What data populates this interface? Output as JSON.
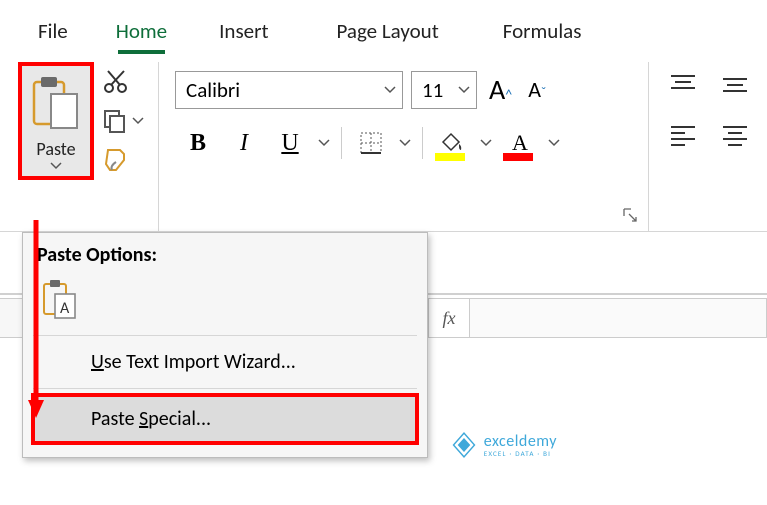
{
  "tabs": {
    "file": "File",
    "home": "Home",
    "insert": "Insert",
    "page_layout": "Page Layout",
    "formulas": "Formulas"
  },
  "clipboard": {
    "paste_label": "Paste"
  },
  "font": {
    "name": "Calibri",
    "size": "11"
  },
  "formula_bar": {
    "fx": "fx"
  },
  "paste_menu": {
    "heading": "Paste Options:",
    "wizard_pre": "",
    "wizard_u": "U",
    "wizard_post": "se Text Import Wizard...",
    "special_pre": "Paste ",
    "special_u": "S",
    "special_post": "pecial..."
  },
  "watermark": {
    "brand": "exceldemy",
    "slogan": "EXCEL · DATA · BI"
  }
}
